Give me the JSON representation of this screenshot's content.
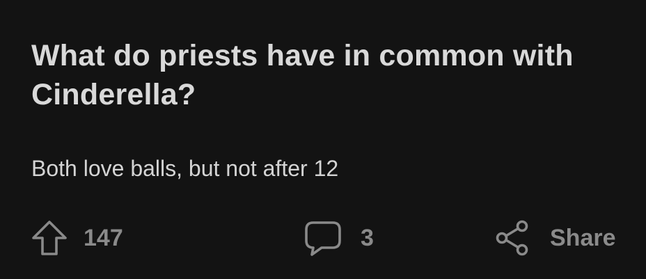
{
  "post": {
    "title": "What do priests have in common with Cinderella?",
    "body": "Both love balls, but not after 12"
  },
  "actions": {
    "upvote": {
      "icon": "upvote-arrow-icon",
      "count": "147"
    },
    "comments": {
      "icon": "comment-bubble-icon",
      "count": "3"
    },
    "share": {
      "icon": "share-icon",
      "label": "Share"
    }
  },
  "colors": {
    "background": "#131313",
    "text": "#d9d9d9",
    "muted": "#8a8a8a"
  }
}
